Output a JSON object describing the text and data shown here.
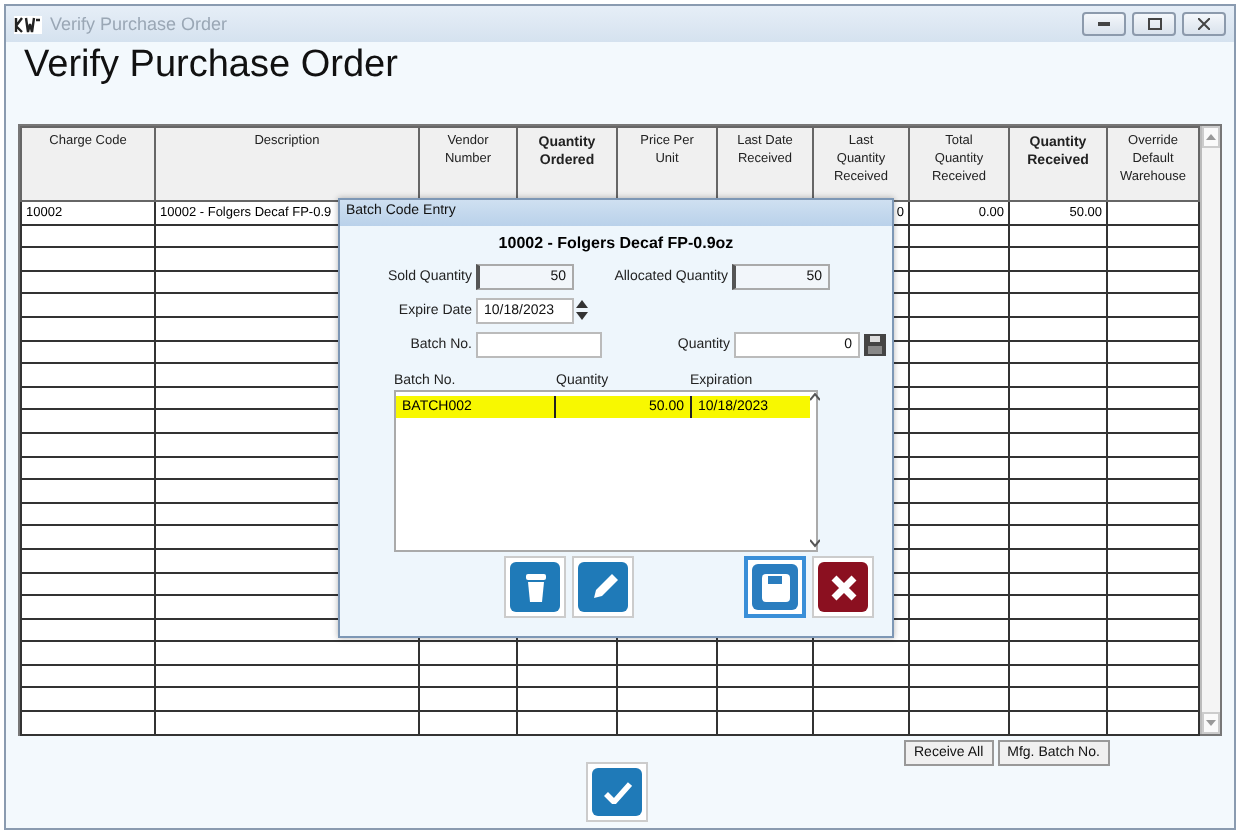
{
  "window": {
    "title": "Verify Purchase Order"
  },
  "page_title": "Verify Purchase Order",
  "table": {
    "columns": [
      {
        "label": "Charge Code",
        "bold": false
      },
      {
        "label": "Description",
        "bold": false
      },
      {
        "label": "Vendor Number",
        "bold": false
      },
      {
        "label": "Quantity Ordered",
        "bold": true
      },
      {
        "label": "Price Per Unit",
        "bold": false
      },
      {
        "label": "Last Date Received",
        "bold": false
      },
      {
        "label": "Last Quantity Received",
        "bold": false
      },
      {
        "label": "Total Quantity Received",
        "bold": false
      },
      {
        "label": "Quantity Received",
        "bold": true
      },
      {
        "label": "Override Default Warehouse",
        "bold": false
      }
    ],
    "rows": [
      {
        "cells": [
          "10002",
          "10002 - Folgers Decaf FP-0.9",
          "",
          "",
          "",
          "",
          "0",
          "0.00",
          "50.00",
          ""
        ]
      }
    ]
  },
  "buttons": [
    {
      "label": "Receive All"
    },
    {
      "label": "Mfg. Batch No."
    }
  ],
  "confirm_button": {
    "kind": "check"
  },
  "dialog": {
    "title": "Batch Code Entry",
    "heading": "10002 - Folgers Decaf FP-0.9oz",
    "sold_quantity": {
      "label": "Sold Quantity",
      "value": "50"
    },
    "allocated_quantity": {
      "label": "Allocated Quantity",
      "value": "50"
    },
    "expire_date": {
      "label": "Expire Date",
      "value": "10/18/2023"
    },
    "batch_no": {
      "label": "Batch No."
    },
    "quantity": {
      "label": "Quantity",
      "value": "0"
    },
    "list": {
      "columns": [
        "Batch No.",
        "Quantity",
        "Expiration"
      ],
      "rows": [
        {
          "cells": [
            "BATCH002",
            "50.00",
            "10/18/2023"
          ],
          "highlighted": true
        }
      ]
    },
    "actions": [
      {
        "kind": "delete",
        "focused": false
      },
      {
        "kind": "edit",
        "focused": false
      },
      {
        "kind": "save",
        "focused": true
      },
      {
        "kind": "cancel",
        "focused": false
      }
    ]
  }
}
